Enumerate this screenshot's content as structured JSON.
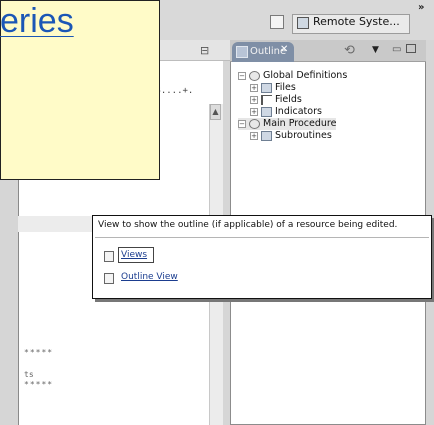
{
  "callout": {
    "text": "eries"
  },
  "toolbar": {
    "perspective_icon": "open-perspective-icon",
    "remote_label": "Remote Syste...",
    "overflow_label": "»"
  },
  "editor": {
    "ruler_text": ".8....+.",
    "stars_top": "*****",
    "tail_text": "ts",
    "stars_bottom": "*****"
  },
  "outline": {
    "tab_label": "Outline",
    "close_label": "✕",
    "tree": [
      {
        "label": "Global Definitions",
        "expander": "−",
        "icon": "gear-icon",
        "level": 0
      },
      {
        "label": "Files",
        "expander": "+",
        "icon": "files-icon",
        "level": 1
      },
      {
        "label": "Fields",
        "expander": "+",
        "icon": "fields-icon",
        "level": 1
      },
      {
        "label": "Indicators",
        "expander": "+",
        "icon": "indicators-icon",
        "level": 1
      },
      {
        "label": "Main Procedure",
        "expander": "−",
        "icon": "gear-icon",
        "level": 0,
        "selected": true
      },
      {
        "label": "Subroutines",
        "expander": "+",
        "icon": "folder-icon",
        "level": 1
      }
    ]
  },
  "tooltip": {
    "description": "View to show the outline (if applicable) of a resource being edited.",
    "links": [
      "Views",
      "Outline View"
    ]
  }
}
